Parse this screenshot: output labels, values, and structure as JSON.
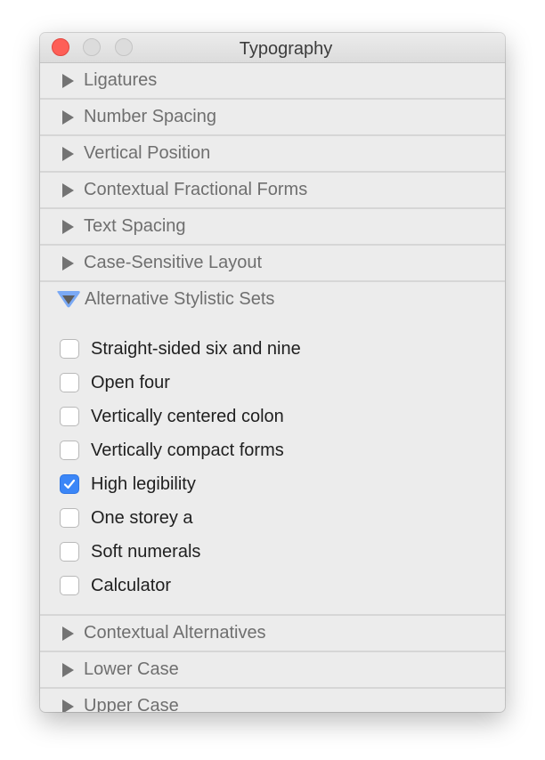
{
  "window": {
    "title": "Typography",
    "controls": [
      "close",
      "minimize",
      "zoom"
    ]
  },
  "sections_before": [
    {
      "label": "Ligatures",
      "expanded": false
    },
    {
      "label": "Number Spacing",
      "expanded": false
    },
    {
      "label": "Vertical Position",
      "expanded": false
    },
    {
      "label": "Contextual Fractional Forms",
      "expanded": false
    },
    {
      "label": "Text Spacing",
      "expanded": false
    },
    {
      "label": "Case-Sensitive Layout",
      "expanded": false
    }
  ],
  "expanded_section": {
    "label": "Alternative Stylistic Sets",
    "expanded": true,
    "options": [
      {
        "label": "Straight-sided six and nine",
        "checked": false
      },
      {
        "label": "Open four",
        "checked": false
      },
      {
        "label": "Vertically centered colon",
        "checked": false
      },
      {
        "label": "Vertically compact forms",
        "checked": false
      },
      {
        "label": "High legibility",
        "checked": true
      },
      {
        "label": "One storey a",
        "checked": false
      },
      {
        "label": "Soft numerals",
        "checked": false
      },
      {
        "label": "Calculator",
        "checked": false
      }
    ]
  },
  "sections_after": [
    {
      "label": "Contextual Alternatives",
      "expanded": false
    },
    {
      "label": "Lower Case",
      "expanded": false
    },
    {
      "label": "Upper Case",
      "expanded": false
    }
  ],
  "colors": {
    "accent": "#3b86f7",
    "close": "#fe5f57"
  }
}
